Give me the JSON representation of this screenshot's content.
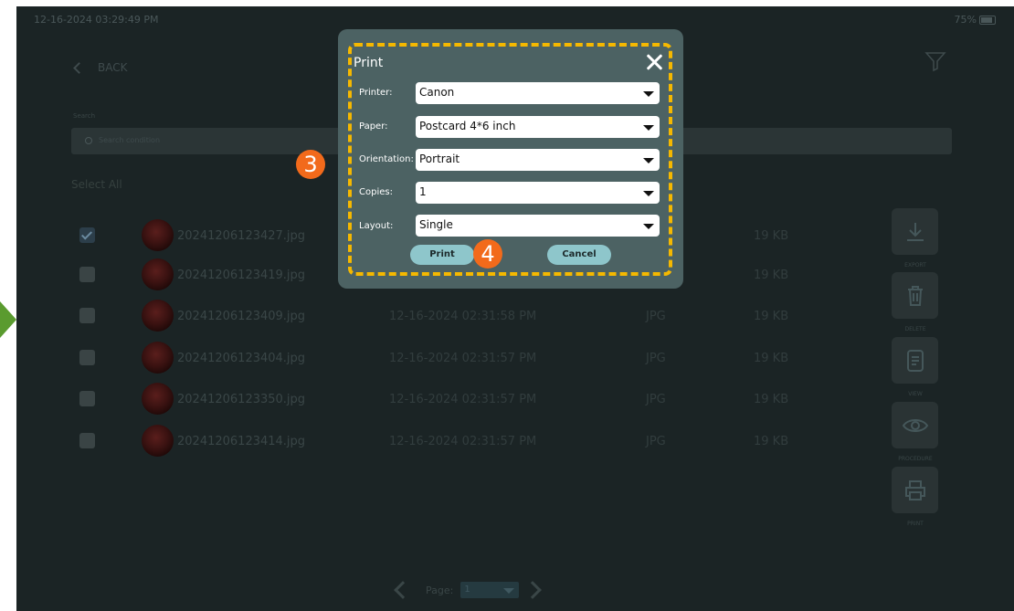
{
  "status": {
    "datetime": "12-16-2024 03:29:49 PM",
    "battery": "75%"
  },
  "header": {
    "back_label": "BACK"
  },
  "search": {
    "label": "Search",
    "placeholder": "Search condition"
  },
  "list": {
    "select_all": "Select All",
    "rows": [
      {
        "checked": true,
        "name": "20241206123427.jpg",
        "date": "",
        "type": "",
        "size": "19 KB"
      },
      {
        "checked": false,
        "name": "20241206123419.jpg",
        "date": "",
        "type": "",
        "size": "19 KB"
      },
      {
        "checked": false,
        "name": "20241206123409.jpg",
        "date": "12-16-2024 02:31:58 PM",
        "type": "JPG",
        "size": "19 KB"
      },
      {
        "checked": false,
        "name": "20241206123404.jpg",
        "date": "12-16-2024 02:31:57 PM",
        "type": "JPG",
        "size": "19 KB"
      },
      {
        "checked": false,
        "name": "20241206123350.jpg",
        "date": "12-16-2024 02:31:57 PM",
        "type": "JPG",
        "size": "19 KB"
      },
      {
        "checked": false,
        "name": "20241206123414.jpg",
        "date": "12-16-2024 02:31:57 PM",
        "type": "JPG",
        "size": "19 KB"
      }
    ]
  },
  "side_actions": {
    "export_label": "EXPORT",
    "delete_label": "DELETE",
    "view_label": "VIEW",
    "procedure_label": "PROCEDURE",
    "print_label": "PRINT"
  },
  "pager": {
    "label": "Page:",
    "value": "1"
  },
  "dialog": {
    "title": "Print",
    "printer_label": "Printer:",
    "printer_value": "Canon",
    "paper_label": "Paper:",
    "paper_value": "Postcard 4*6 inch",
    "orientation_label": "Orientation:",
    "orientation_value": "Portrait",
    "copies_label": "Copies:",
    "copies_value": "1",
    "layout_label": "Layout:",
    "layout_value": "Single",
    "print_button": "Print",
    "cancel_button": "Cancel"
  },
  "annotations": {
    "step3": "3",
    "step4": "4",
    "highlight_color": "#f5b800",
    "badge_color": "#f26a1b",
    "arrow_color": "#5a9b2f"
  }
}
